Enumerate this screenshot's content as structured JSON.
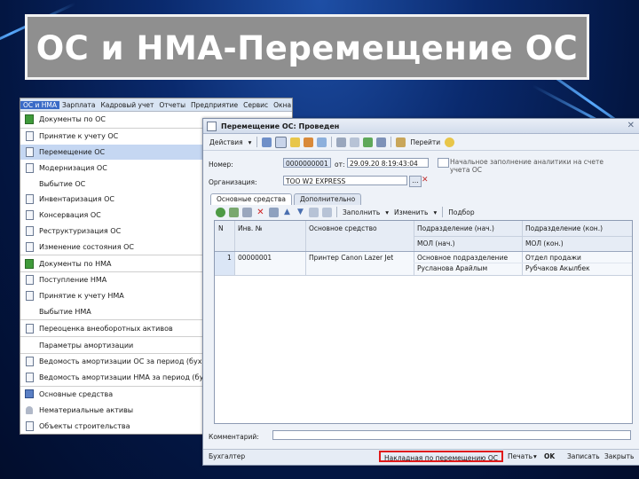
{
  "slide": {
    "title": "ОС и НМА-Перемещение ОС"
  },
  "menu": {
    "menubar": [
      "ОС и НМА",
      "Зарплата",
      "Кадровый учет",
      "Отчеты",
      "Предприятие",
      "Сервис",
      "Окна"
    ],
    "items": [
      {
        "label": "Документы по ОС",
        "icon": "green-doc-icon"
      },
      {
        "label": "Принятие к учету ОС",
        "icon": "document-icon"
      },
      {
        "label": "Перемещение ОС",
        "icon": "document-icon"
      },
      {
        "label": "Модернизация ОС",
        "icon": "document-icon"
      },
      {
        "label": "Выбытие ОС",
        "icon": "none"
      },
      {
        "label": "Инвентаризация ОС",
        "icon": "document-icon"
      },
      {
        "label": "Консервация ОС",
        "icon": "document-icon"
      },
      {
        "label": "Реструктуризация ОС",
        "icon": "document-icon"
      },
      {
        "label": "Изменение состояния ОС",
        "icon": "document-icon"
      },
      {
        "label": "Документы по НМА",
        "icon": "green-doc-icon"
      },
      {
        "label": "Поступление НМА",
        "icon": "document-icon"
      },
      {
        "label": "Принятие к учету НМА",
        "icon": "document-icon"
      },
      {
        "label": "Выбытие НМА",
        "icon": "none"
      },
      {
        "label": "Переоценка внеоборотных активов",
        "icon": "document-icon"
      },
      {
        "label": "Параметры амортизации",
        "icon": "none"
      },
      {
        "label": "Ведомость амортизации ОС за период (бухг.)",
        "icon": "document-icon"
      },
      {
        "label": "Ведомость амортизации НМА за период (бухг.)",
        "icon": "document-icon"
      },
      {
        "label": "Основные средства",
        "icon": "car-icon"
      },
      {
        "label": "Нематериальные активы",
        "icon": "person-icon"
      },
      {
        "label": "Объекты строительства",
        "icon": "document-icon"
      }
    ]
  },
  "window": {
    "title": "Перемещение ОС: Проведен",
    "toolbar": {
      "actions_label": "Действия",
      "goto_label": "Перейти"
    },
    "number_label": "Номер:",
    "number_value": "0000000001",
    "date_label": "от:",
    "date_value": "29.09.20  8:19:43:04",
    "checkbox_label": "Начальное заполнение аналитики на счете учета ОС",
    "org_label": "Организация:",
    "org_value": "ТОО W2 EXPRESS",
    "tabs": [
      "Основные средства",
      "Дополнительно"
    ],
    "grid_toolbar": {
      "fill_label": "Заполнить",
      "change_label": "Изменить",
      "select_label": "Подбор"
    },
    "grid": {
      "headers": {
        "num": "N",
        "inv": "Инв. №",
        "asset": "Основное средство",
        "from_dept": "Подразделение (нач.)",
        "from_mol": "МОЛ (нач.)",
        "to_dept": "Подразделение (кон.)",
        "to_mol": "МОЛ (кон.)"
      },
      "rows": [
        {
          "num": "1",
          "inv": "00000001",
          "asset": "Принтер Canon Lazer Jet",
          "from_dept": "Основное подразделение",
          "from_mol": "Русланова Арайлым",
          "to_dept": "Отдел продажи",
          "to_mol": "Рубчаков Акылбек"
        }
      ]
    },
    "comment_label": "Комментарий:",
    "comment_value": "",
    "status": {
      "left": "Бухгалтер",
      "print_form": "Накладная по перемещению ОС",
      "print_label": "Печать",
      "ok_label": "OK",
      "save_label": "Записать",
      "close_label": "Закрыть"
    }
  }
}
